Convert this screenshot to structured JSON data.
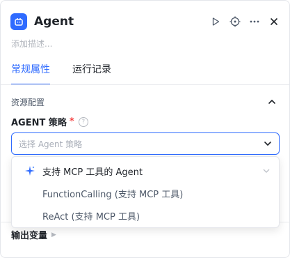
{
  "header": {
    "title": "Agent",
    "description_placeholder": "添加描述..."
  },
  "tabs": [
    {
      "label": "常规属性",
      "active": true
    },
    {
      "label": "运行记录",
      "active": false
    }
  ],
  "section": {
    "title": "资源配置"
  },
  "field": {
    "label": "AGENT 策略",
    "required_mark": "*",
    "help_glyph": "?"
  },
  "select": {
    "placeholder": "选择 Agent 策略"
  },
  "dropdown": {
    "options": [
      {
        "label": "支持 MCP 工具的 Agent",
        "icon": "sparkle-icon"
      },
      {
        "label": "FunctionCalling (支持 MCP 工具)"
      },
      {
        "label": "ReAct (支持 MCP 工具)"
      }
    ]
  },
  "output": {
    "label": "输出变量"
  },
  "colors": {
    "accent": "#2f6bff",
    "required": "#f53f3f"
  }
}
